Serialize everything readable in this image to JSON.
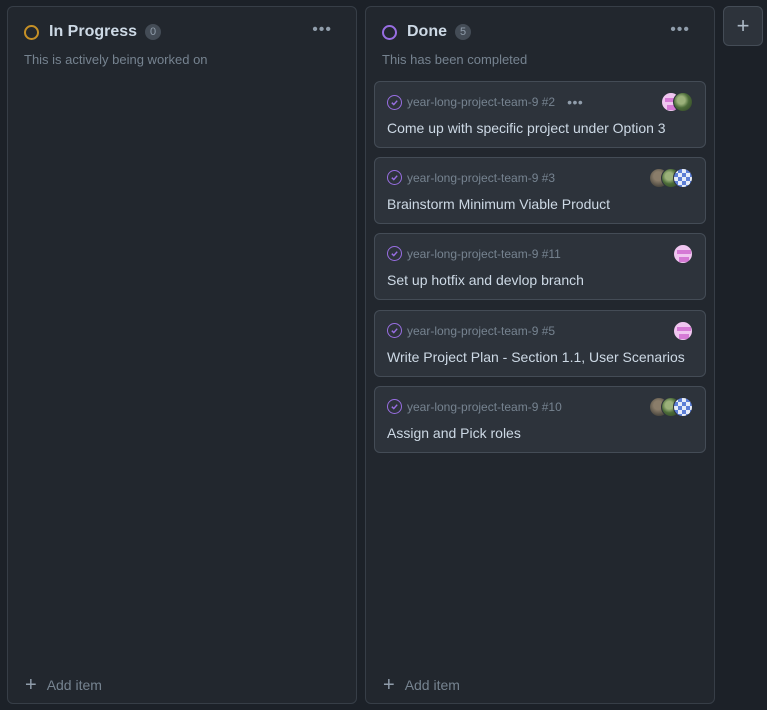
{
  "columns": [
    {
      "title": "In Progress",
      "count": "0",
      "description": "This is actively being worked on",
      "status_color": "#c69026",
      "more_label": "•••",
      "add_item_label": "Add item"
    },
    {
      "title": "Done",
      "count": "5",
      "description": "This has been completed",
      "status_color": "#986ee2",
      "more_label": "•••",
      "add_item_label": "Add item"
    }
  ],
  "cards": [
    {
      "repo_ref": "year-long-project-team-9 #2",
      "title": "Come up with specific project under Option 3",
      "menu_label": "•••",
      "avatars": [
        "pink-avatar",
        "green-avatar"
      ]
    },
    {
      "repo_ref": "year-long-project-team-9 #3",
      "title": "Brainstorm Minimum Viable Product",
      "avatars": [
        "brown-avatar",
        "green-avatar",
        "checker-avatar"
      ]
    },
    {
      "repo_ref": "year-long-project-team-9 #11",
      "title": "Set up hotfix and devlop branch",
      "avatars": [
        "pink-avatar"
      ]
    },
    {
      "repo_ref": "year-long-project-team-9 #5",
      "title": "Write Project Plan - Section 1.1, User Scenarios",
      "avatars": [
        "pink-avatar"
      ]
    },
    {
      "repo_ref": "year-long-project-team-9 #10",
      "title": "Assign and Pick roles",
      "avatars": [
        "brown-avatar",
        "green-avatar",
        "checker-avatar"
      ]
    }
  ],
  "add_column_label": "+",
  "icons": {
    "add": "plus-icon",
    "check": "check-circle-icon",
    "status": "circle-icon"
  }
}
